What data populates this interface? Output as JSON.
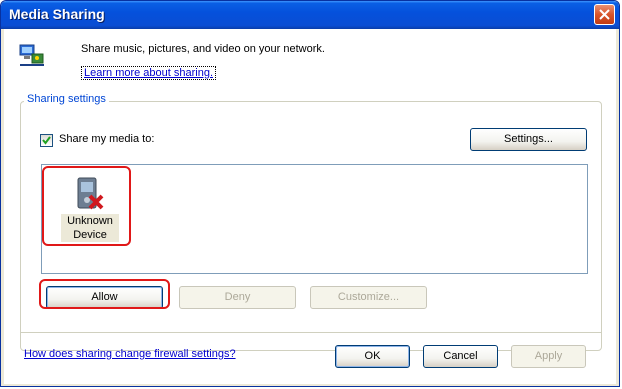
{
  "window": {
    "title": "Media Sharing"
  },
  "header": {
    "description": "Share music, pictures, and video on your network.",
    "learn_more_link": "Learn more about sharing."
  },
  "sharing_settings": {
    "group_label": "Sharing settings",
    "share_checkbox": {
      "label": "Share my media to:",
      "checked": true
    },
    "settings_button": "Settings...",
    "devices": [
      {
        "name_line1": "Unknown",
        "name_line2": "Device",
        "icon": "denied-device-icon"
      }
    ],
    "allow_button": "Allow",
    "deny_button": "Deny",
    "customize_button": "Customize..."
  },
  "footer": {
    "firewall_link": "How does sharing change firewall settings?",
    "ok_button": "OK",
    "cancel_button": "Cancel",
    "apply_button": "Apply"
  },
  "colors": {
    "title_bar": "#0551dc",
    "highlight": "#e01818",
    "link": "#0000cc"
  }
}
